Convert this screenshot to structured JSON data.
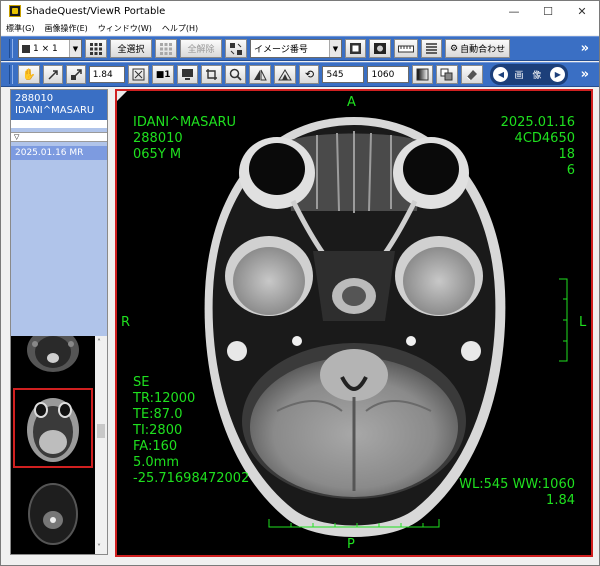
{
  "window": {
    "title": "ShadeQuest/ViewR Portable",
    "controls": {
      "minimize": "—",
      "maximize": "☐",
      "close": "✕"
    }
  },
  "menu": [
    "標準(G)",
    "画像操作(E)",
    "ウィンドウ(W)",
    "ヘルプ(H)"
  ],
  "toolbar1": {
    "layout_value": "1 × 1",
    "select_all": "全選択",
    "deselect_all": "全解除",
    "sort_select": "イメージ番号",
    "fit_label": "自動合わせ",
    "more": "»"
  },
  "toolbar2": {
    "zoom_value": "1.84",
    "window_level": "545",
    "window_width": "1060",
    "nav_label": "画 像",
    "more": "»"
  },
  "left_panel": {
    "patient_id": "288010",
    "patient_name": "IDANI^MASARU",
    "study_column": "▽",
    "study_row": "2025.01.16    MR"
  },
  "viewer": {
    "orient_top": "A",
    "orient_bottom": "P",
    "orient_left": "R",
    "orient_right": "L",
    "top_left": [
      "IDANI^MASARU",
      "288010",
      "065Y M"
    ],
    "top_right": [
      "2025.01.16",
      "4CD4650",
      "18",
      "6"
    ],
    "bottom_left": [
      "SE",
      "TR:12000",
      "TE:87.0",
      "TI:2800",
      "FA:160",
      "5.0mm",
      "-25.71698472002"
    ],
    "bottom_right": [
      "WL:545 WW:1060",
      "1.84"
    ]
  },
  "colors": {
    "overlay_text": "#1fe01f",
    "toolbar_blue": "#3a6fc4",
    "selection_red": "#d02020"
  }
}
